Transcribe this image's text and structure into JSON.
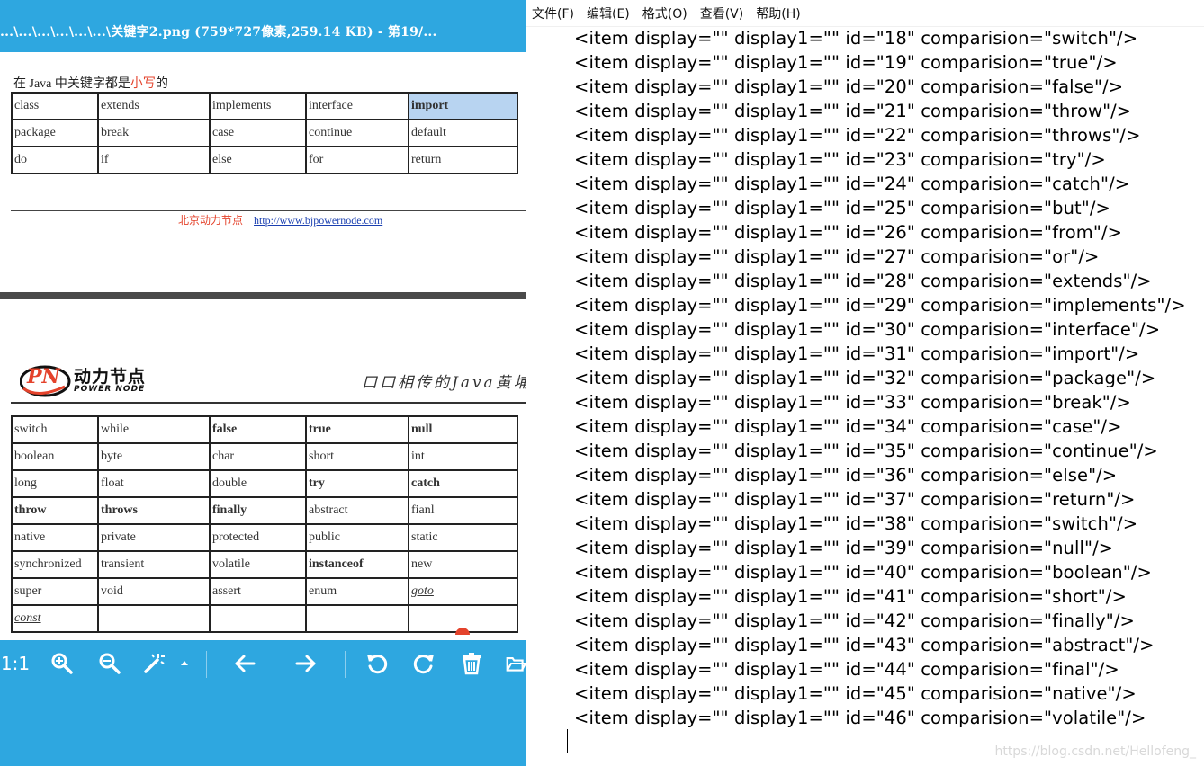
{
  "viewer": {
    "title": "...\\...\\...\\...\\...\\...\\关键字2.png (759*727像素,259.14 KB) - 第19/...",
    "page1": {
      "heading_prefix": "在 Java 中关键字都是",
      "heading_red": "小写",
      "heading_suffix": "的",
      "table": [
        [
          "class",
          "extends",
          "implements",
          "interface",
          "import"
        ],
        [
          "package",
          "break",
          "case",
          "continue",
          "default"
        ],
        [
          "do",
          "if",
          "else",
          "for",
          "return"
        ]
      ],
      "footer_org": "北京动力节点",
      "footer_url": "http://www.bjpowernode.com"
    },
    "page2": {
      "logo_cn": "动力节点",
      "logo_en": "POWER NODE",
      "logo_mark": "PN",
      "slogan": "口口相传的Java黄埔",
      "table": [
        [
          "switch",
          "while",
          "false",
          "true",
          "null"
        ],
        [
          "boolean",
          "byte",
          "char",
          "short",
          "int"
        ],
        [
          "long",
          "float",
          "double",
          "try",
          "catch"
        ],
        [
          "throw",
          "throws",
          "finally",
          "abstract",
          "fianl"
        ],
        [
          "native",
          "private",
          "protected",
          "public",
          "static"
        ],
        [
          "synchronized",
          "transient",
          "volatile",
          "instanceof",
          "new"
        ],
        [
          "super",
          "void",
          "assert",
          "enum",
          "goto"
        ],
        [
          "const",
          "",
          "",
          "",
          ""
        ]
      ]
    },
    "toolbar": {
      "zoom_label": "1:1",
      "icons": [
        "zoom-in-icon",
        "zoom-out-icon",
        "magic-wand-icon",
        "dropdown-arrow-icon",
        "arrow-left-icon",
        "arrow-right-icon",
        "rotate-left-icon",
        "rotate-right-icon",
        "trash-icon",
        "folder-icon"
      ]
    },
    "colors": {
      "accent": "#2ea7e0",
      "red": "#e4432c",
      "link": "#1a3fb0"
    }
  },
  "notepad": {
    "menu": [
      "文件(F)",
      "编辑(E)",
      "格式(O)",
      "查看(V)",
      "帮助(H)"
    ],
    "lines": [
      "<item display=\"\" display1=\"\" id=\"18\" comparision=\"switch\"/>",
      "<item display=\"\" display1=\"\" id=\"19\" comparision=\"true\"/>",
      "<item display=\"\" display1=\"\" id=\"20\" comparision=\"false\"/>",
      "<item display=\"\" display1=\"\" id=\"21\" comparision=\"throw\"/>",
      "<item display=\"\" display1=\"\" id=\"22\" comparision=\"throws\"/>",
      "<item display=\"\" display1=\"\" id=\"23\" comparision=\"try\"/>",
      "<item display=\"\" display1=\"\" id=\"24\" comparision=\"catch\"/>",
      "<item display=\"\" display1=\"\" id=\"25\" comparision=\"but\"/>",
      "<item display=\"\" display1=\"\" id=\"26\" comparision=\"from\"/>",
      "<item display=\"\" display1=\"\" id=\"27\" comparision=\"or\"/>",
      "<item display=\"\" display1=\"\" id=\"28\" comparision=\"extends\"/>",
      "<item display=\"\" display1=\"\" id=\"29\" comparision=\"implements\"/>",
      "<item display=\"\" display1=\"\" id=\"30\" comparision=\"interface\"/>",
      "<item display=\"\" display1=\"\" id=\"31\" comparision=\"import\"/>",
      "<item display=\"\" display1=\"\" id=\"32\" comparision=\"package\"/>",
      "<item display=\"\" display1=\"\" id=\"33\" comparision=\"break\"/>",
      "<item display=\"\" display1=\"\" id=\"34\" comparision=\"case\"/>",
      "<item display=\"\" display1=\"\" id=\"35\" comparision=\"continue\"/>",
      "<item display=\"\" display1=\"\" id=\"36\" comparision=\"else\"/>",
      "<item display=\"\" display1=\"\" id=\"37\" comparision=\"return\"/>",
      "<item display=\"\" display1=\"\" id=\"38\" comparision=\"switch\"/>",
      "<item display=\"\" display1=\"\" id=\"39\" comparision=\"null\"/>",
      "<item display=\"\" display1=\"\" id=\"40\" comparision=\"boolean\"/>",
      "<item display=\"\" display1=\"\" id=\"41\" comparision=\"short\"/>",
      "<item display=\"\" display1=\"\" id=\"42\" comparision=\"finally\"/>",
      "<item display=\"\" display1=\"\" id=\"43\" comparision=\"abstract\"/>",
      "<item display=\"\" display1=\"\" id=\"44\" comparision=\"final\"/>",
      "<item display=\"\" display1=\"\" id=\"45\" comparision=\"native\"/>",
      "<item display=\"\" display1=\"\" id=\"46\" comparision=\"volatile\"/>"
    ],
    "watermark": "https://blog.csdn.net/Hellofeng_"
  }
}
